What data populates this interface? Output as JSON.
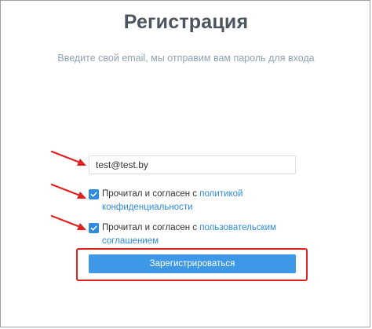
{
  "page": {
    "title": "Регистрация",
    "subtitle": "Введите свой email, мы отправим вам пароль для входа"
  },
  "form": {
    "email_value": "test@test.by",
    "privacy": {
      "checked": true,
      "text": "Прочитал и согласен с ",
      "link_line1": "политикой",
      "link_line2": "конфиденциальности"
    },
    "terms": {
      "checked": true,
      "text": "Прочитал и согласен с ",
      "link_line1": "пользовательским",
      "link_line2": "соглашением"
    },
    "submit_label": "Зарегистрироваться"
  },
  "colors": {
    "accent": "#2f8be0",
    "button": "#3d98e8",
    "annotation": "#e12020",
    "title": "#4a5560",
    "subtitle": "#8fa3b5"
  },
  "icons": {
    "checkbox": "check-icon",
    "annotation": "red-arrow-icon"
  }
}
